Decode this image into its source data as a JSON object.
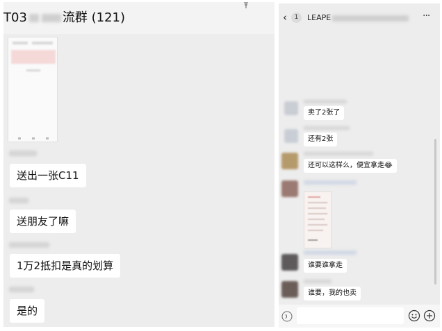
{
  "left_chat": {
    "title_prefix": "T03",
    "title_suffix": "流群 (121)",
    "messages": [
      {
        "text": "送出一张C11"
      },
      {
        "text": "送朋友了嘛"
      },
      {
        "text": "1万2抵扣是真的划算"
      },
      {
        "text": "是的"
      }
    ]
  },
  "right_chat": {
    "back_badge": "1",
    "title": "LEAPE",
    "messages": [
      {
        "text": "卖了2张了"
      },
      {
        "text": "还有2张"
      },
      {
        "text": "还可以这样么，便宜拿走😂"
      },
      {
        "text": "谁要谁拿走"
      },
      {
        "text": "谁要，我的也卖"
      }
    ]
  }
}
